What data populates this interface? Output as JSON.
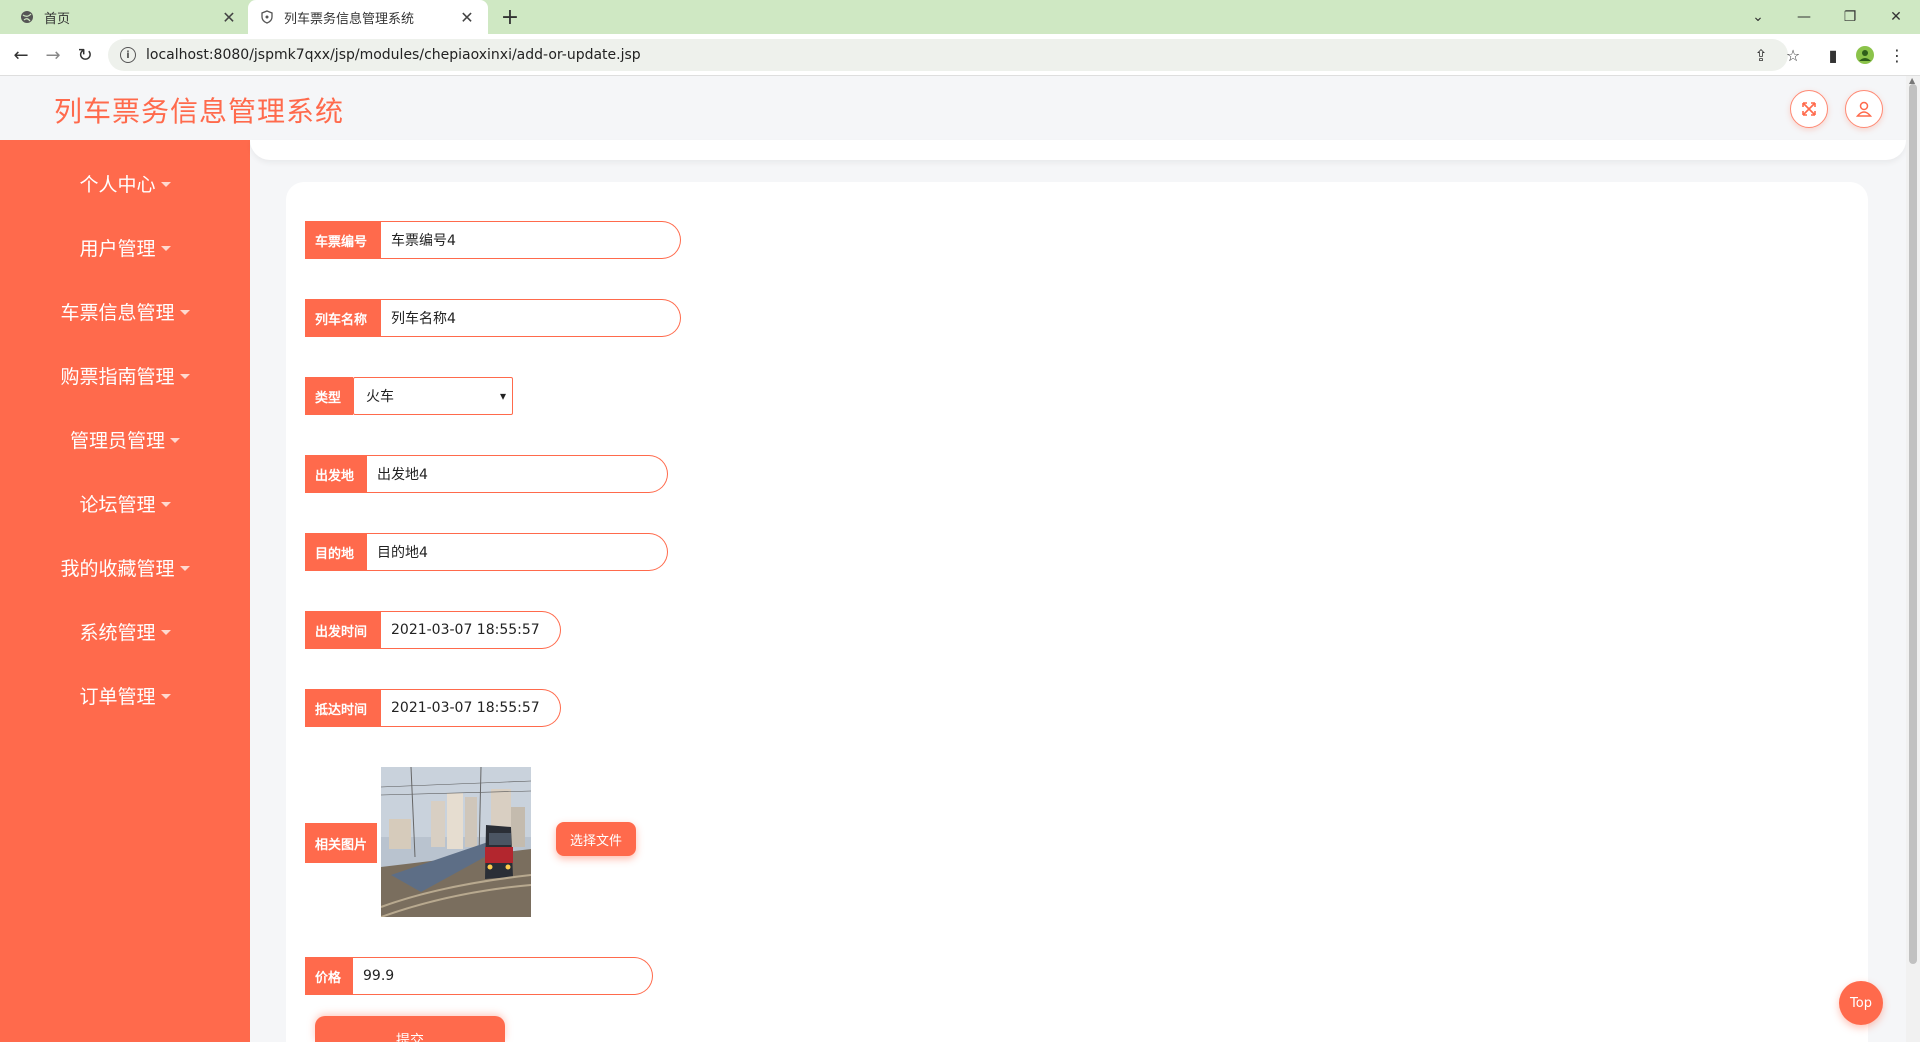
{
  "browser": {
    "tabs": [
      {
        "label": "首页"
      },
      {
        "label": "列车票务信息管理系统"
      }
    ],
    "url": "localhost:8080/jspmk7qxx/jsp/modules/chepiaoxinxi/add-or-update.jsp"
  },
  "app": {
    "title": "列车票务信息管理系统"
  },
  "sidebar": {
    "items": [
      {
        "label": "个人中心"
      },
      {
        "label": "用户管理"
      },
      {
        "label": "车票信息管理"
      },
      {
        "label": "购票指南管理"
      },
      {
        "label": "管理员管理"
      },
      {
        "label": "论坛管理"
      },
      {
        "label": "我的收藏管理"
      },
      {
        "label": "系统管理"
      },
      {
        "label": "订单管理"
      }
    ]
  },
  "form": {
    "ticket_no": {
      "label": "车票编号",
      "value": "车票编号4"
    },
    "train_name": {
      "label": "列车名称",
      "value": "列车名称4"
    },
    "type": {
      "label": "类型",
      "value": "火车"
    },
    "origin": {
      "label": "出发地",
      "value": "出发地4"
    },
    "destination": {
      "label": "目的地",
      "value": "目的地4"
    },
    "depart_time": {
      "label": "出发时间",
      "value": "2021-03-07 18:55:57"
    },
    "arrive_time": {
      "label": "抵达时间",
      "value": "2021-03-07 18:55:57"
    },
    "image": {
      "label": "相关图片",
      "button": "选择文件"
    },
    "price": {
      "label": "价格",
      "value": "99.9"
    },
    "submit": "提交"
  },
  "top_button": "Top",
  "colors": {
    "accent": "#ff6a4c",
    "tabbar": "#cfe8c3",
    "page_bg": "#f5f6f8"
  }
}
